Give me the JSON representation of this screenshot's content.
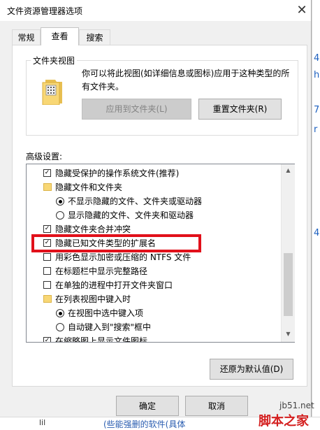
{
  "dialog": {
    "title": "文件资源管理器选项",
    "close_icon": "close-icon"
  },
  "tabs": [
    {
      "label": "常规",
      "selected": false
    },
    {
      "label": "查看",
      "selected": true
    },
    {
      "label": "搜索",
      "selected": false
    }
  ],
  "folder_view": {
    "group_label": "文件夹视图",
    "description": "你可以将此视图(如详细信息或图标)应用于这种类型的所有文件夹。",
    "apply_button": "应用到文件夹(L)",
    "reset_button": "重置文件夹(R)"
  },
  "advanced": {
    "label": "高级设置:",
    "items": [
      {
        "type": "checkbox",
        "checked": true,
        "label": "隐藏受保护的操作系统文件(推荐)"
      },
      {
        "type": "folder",
        "label": "隐藏文件和文件夹"
      },
      {
        "type": "radio",
        "selected": true,
        "label": "不显示隐藏的文件、文件夹或驱动器"
      },
      {
        "type": "radio",
        "selected": false,
        "label": "显示隐藏的文件、文件夹和驱动器"
      },
      {
        "type": "checkbox",
        "checked": true,
        "label": "隐藏文件夹合并冲突"
      },
      {
        "type": "checkbox",
        "checked": true,
        "label": "隐藏已知文件类型的扩展名"
      },
      {
        "type": "checkbox",
        "checked": false,
        "label": "用彩色显示加密或压缩的 NTFS 文件"
      },
      {
        "type": "checkbox",
        "checked": false,
        "label": "在标题栏中显示完整路径"
      },
      {
        "type": "checkbox",
        "checked": false,
        "label": "在单独的进程中打开文件夹窗口"
      },
      {
        "type": "folder",
        "label": "在列表视图中键入时"
      },
      {
        "type": "radio",
        "selected": true,
        "label": "在视图中选中键入项"
      },
      {
        "type": "radio",
        "selected": false,
        "label": "自动键入到\"搜索\"框中"
      },
      {
        "type": "checkbox",
        "checked": true,
        "label": "在缩略图上显示文件图标"
      }
    ],
    "restore_button": "还原为默认值(D)"
  },
  "footer": {
    "ok_button": "确定",
    "cancel_button": "取消"
  },
  "background": {
    "right_fragments": [
      "4",
      "h",
      "7",
      "r",
      "4"
    ],
    "bottom_left": "lil",
    "bottom_text": "(些能强删的软件(具体"
  },
  "watermark": {
    "url": "jb51.net",
    "name": "脚本之家"
  },
  "colors": {
    "highlight_border": "#e1101a",
    "folder_yellow": "#f8d775"
  }
}
